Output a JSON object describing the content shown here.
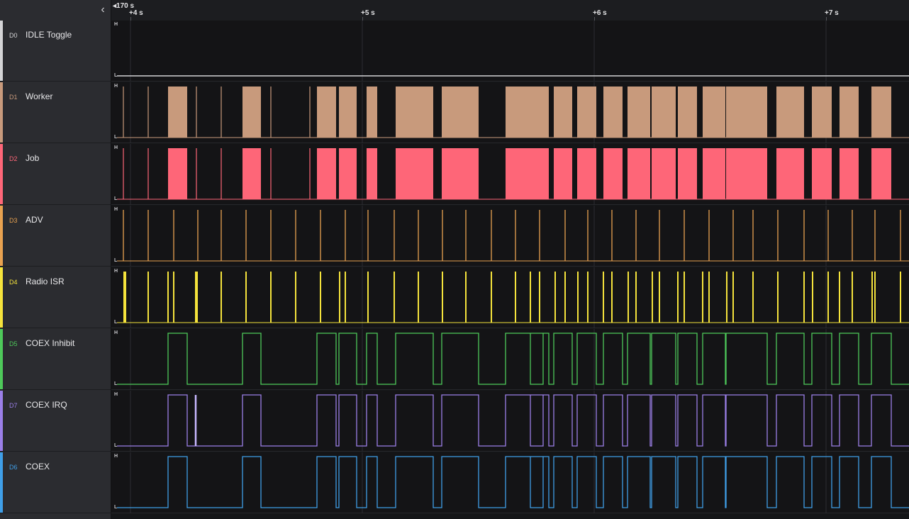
{
  "timeline": {
    "origin_label": "170 s",
    "ticks": [
      "+4 s",
      "+5 s",
      "+6 s",
      "+7 s"
    ]
  },
  "sidebar": {
    "collapse_icon": "chevron-left-icon"
  },
  "levels": {
    "high": "H",
    "low": "L"
  },
  "channels": [
    {
      "id": "D0",
      "name": "IDLE Toggle",
      "color": "#d4d4d6",
      "style": "flat"
    },
    {
      "id": "D1",
      "name": "Worker",
      "color": "#c89a7c",
      "style": "fill"
    },
    {
      "id": "D2",
      "name": "Job",
      "color": "#fe6678",
      "style": "fill"
    },
    {
      "id": "D3",
      "name": "ADV",
      "color": "#e8a250",
      "style": "pulse"
    },
    {
      "id": "D4",
      "name": "Radio ISR",
      "color": "#f5e33c",
      "style": "pulse"
    },
    {
      "id": "D5",
      "name": "COEX Inhibit",
      "color": "#4ec95a",
      "style": "line"
    },
    {
      "id": "D7",
      "name": "COEX IRQ",
      "color": "#9b7fe8",
      "style": "line"
    },
    {
      "id": "D6",
      "name": "COEX",
      "color": "#3f9fe8",
      "style": "line"
    }
  ]
}
